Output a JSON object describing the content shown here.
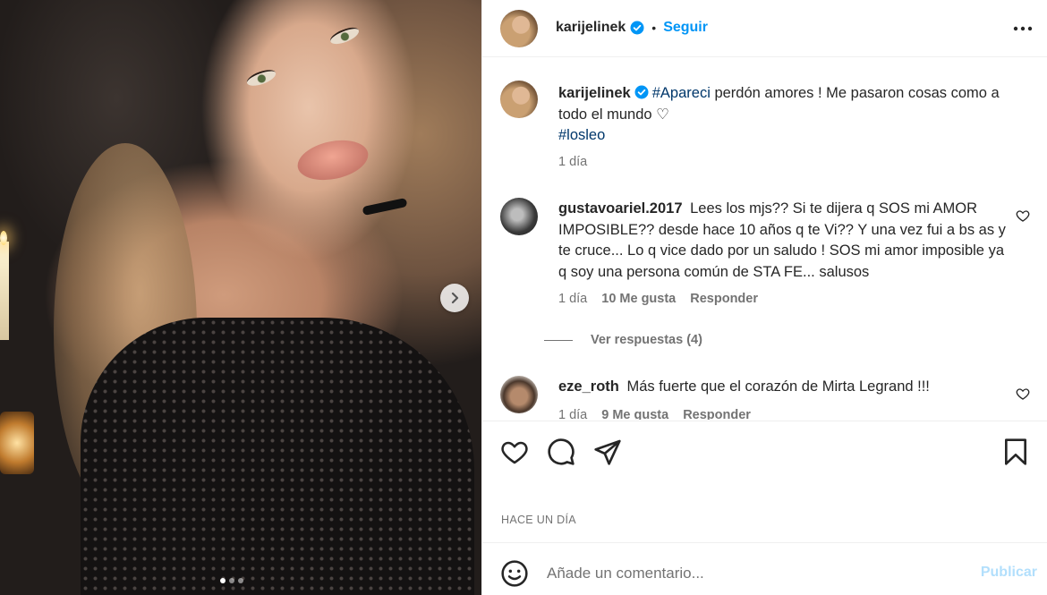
{
  "post": {
    "author": "karijelinek",
    "follow_label": "Seguir",
    "separator": "•",
    "carousel": {
      "total_images": 3,
      "active_index": 0
    }
  },
  "caption": {
    "username": "karijelinek",
    "hashtag": "#Apareci",
    "text": " perdón amores ! Me pasaron cosas como a todo el mundo ♡",
    "hashtag2": "#losleo",
    "time": "1 día"
  },
  "comments": [
    {
      "username": "gustavoariel.2017",
      "text": "Lees los mjs?? Si te dijera q SOS mi AMOR IMPOSIBLE?? desde hace 10 años q te Vi?? Y una vez fui a bs as y te cruce... Lo q vice dado por un saludo ! SOS mi amor imposible ya q soy una persona común de STA FE... salusos",
      "time": "1 día",
      "likes": "10 Me gusta",
      "reply_label": "Responder",
      "view_replies": "Ver respuestas (4)"
    },
    {
      "username": "eze_roth",
      "text": "Más fuerte que el corazón de Mirta Legrand !!!",
      "time": "1 día",
      "likes": "9 Me gusta",
      "reply_label": "Responder"
    }
  ],
  "timestamp": "HACE UN DÍA",
  "composer": {
    "placeholder": "Añade un comentario...",
    "publish_label": "Publicar"
  },
  "colors": {
    "accent": "#0095f6",
    "hashtag": "#00376b",
    "muted": "#737373",
    "publish_disabled": "#b2dffc"
  },
  "icons": [
    "chevron-right-icon",
    "verified-badge-icon",
    "more-options-icon",
    "heart-icon",
    "comment-icon",
    "share-icon",
    "bookmark-icon",
    "emoji-icon"
  ]
}
